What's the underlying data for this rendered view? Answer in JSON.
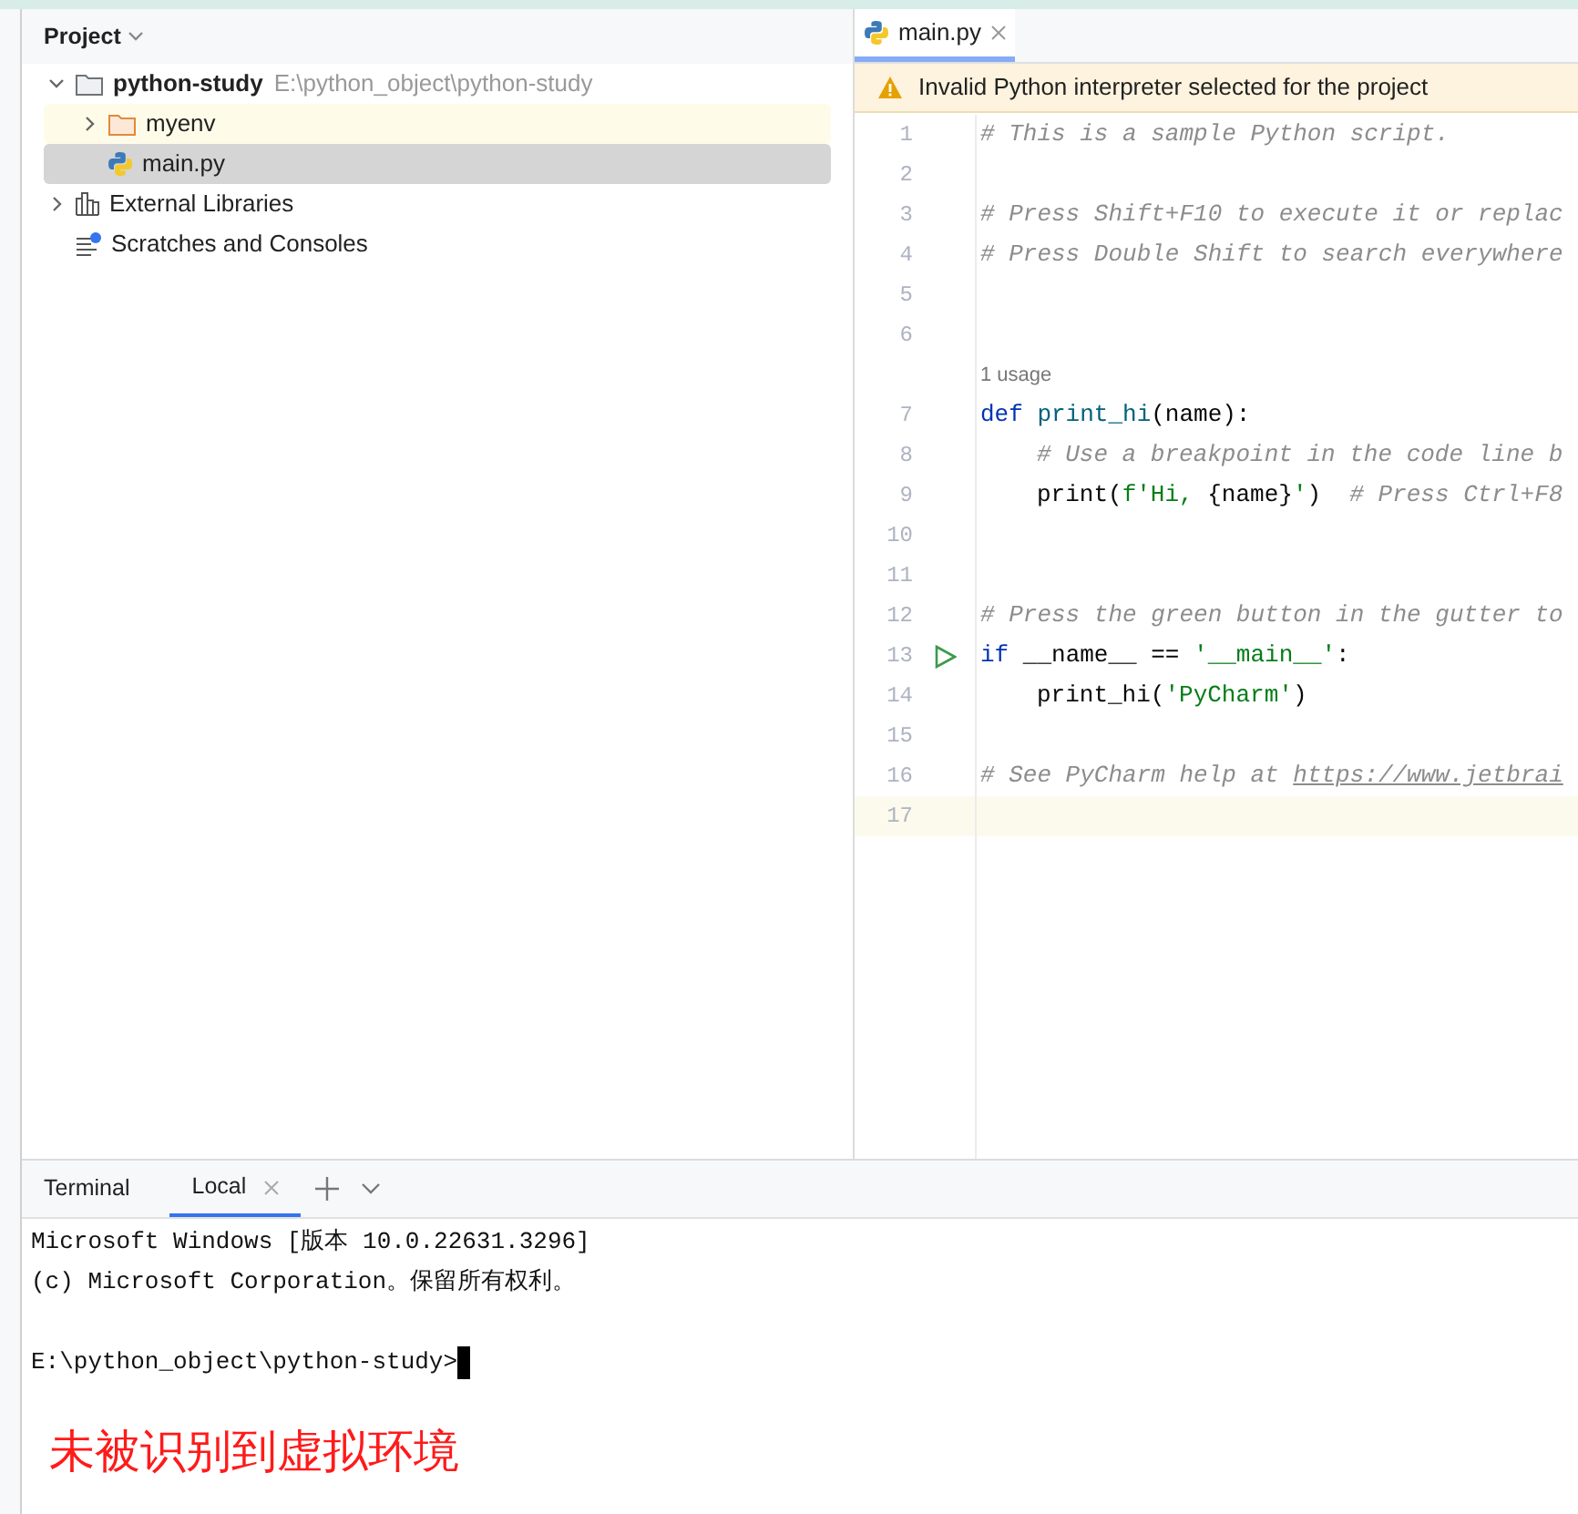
{
  "project_panel": {
    "title": "Project",
    "tree": [
      {
        "kind": "project",
        "label": "python-study",
        "path": "E:\\python_object\\python-study",
        "expanded": true,
        "selected": false,
        "children": [
          {
            "kind": "folder",
            "label": "myenv",
            "expanded": false,
            "selected": false
          },
          {
            "kind": "python",
            "label": "main.py",
            "selected": true
          }
        ]
      },
      {
        "kind": "libraries",
        "label": "External Libraries",
        "expanded": false,
        "selected": false
      },
      {
        "kind": "scratches",
        "label": "Scratches and Consoles",
        "selected": false
      }
    ]
  },
  "editor": {
    "tabs": [
      {
        "label": "main.py",
        "selected": true
      }
    ],
    "warning": "Invalid Python interpreter selected for the project",
    "lines": [
      {
        "number": "1",
        "tokens": [
          {
            "kind": "comment",
            "text": "# This is a sample Python script."
          }
        ]
      },
      {
        "number": "2"
      },
      {
        "number": "3",
        "tokens": [
          {
            "kind": "comment",
            "text": "# Press Shift+F10 to execute it or replac"
          }
        ]
      },
      {
        "number": "4",
        "tokens": [
          {
            "kind": "comment",
            "text": "# Press Double Shift to search everywhere"
          }
        ]
      },
      {
        "number": "5"
      },
      {
        "number": "6"
      },
      {
        "number": "7",
        "hint": "1 usage",
        "tokens": [
          {
            "kind": "keyword",
            "text": "def"
          },
          {
            "kind": "func",
            "text": " print_hi"
          },
          {
            "kind": "plain",
            "text": "(name):"
          }
        ]
      },
      {
        "number": "8",
        "indented": true,
        "tokens": [
          {
            "kind": "comment",
            "text": "# Use a breakpoint in the code line b"
          }
        ]
      },
      {
        "number": "9",
        "indented": true,
        "tokens": [
          {
            "kind": "plain",
            "text": "print("
          },
          {
            "kind": "string",
            "text": "f'Hi, "
          },
          {
            "kind": "plain",
            "text": "{name}"
          },
          {
            "kind": "string",
            "text": "'"
          },
          {
            "kind": "plain",
            "text": ")"
          },
          {
            "kind": "comment",
            "text": "  # Press Ctrl+F8"
          }
        ]
      },
      {
        "number": "10"
      },
      {
        "number": "11"
      },
      {
        "number": "12",
        "tokens": [
          {
            "kind": "comment",
            "text": "# Press the green button in the gutter to"
          }
        ]
      },
      {
        "number": "13",
        "run": true,
        "tokens": [
          {
            "kind": "keyword",
            "text": "if"
          },
          {
            "kind": "plain",
            "text": " __name__ == "
          },
          {
            "kind": "string",
            "text": "'__main__'"
          },
          {
            "kind": "plain",
            "text": ":"
          }
        ]
      },
      {
        "number": "14",
        "indented": true,
        "tokens": [
          {
            "kind": "plain",
            "text": "print_hi("
          },
          {
            "kind": "string",
            "text": "'PyCharm'"
          },
          {
            "kind": "plain",
            "text": ")"
          }
        ]
      },
      {
        "number": "15"
      },
      {
        "number": "16",
        "tokens": [
          {
            "kind": "comment",
            "text": "# See PyCharm help at "
          },
          {
            "kind": "link",
            "text": "https://www.jetbrai"
          }
        ]
      },
      {
        "number": "17",
        "current": true
      }
    ]
  },
  "terminal": {
    "title": "Terminal",
    "tabs": [
      {
        "label": "Local",
        "selected": true
      }
    ],
    "lines": [
      "Microsoft Windows [版本 10.0.22631.3296]",
      "(c) Microsoft Corporation。保留所有权利。"
    ],
    "prompt": "E:\\python_object\\python-study>"
  },
  "annotation": "未被识别到虚拟环境"
}
